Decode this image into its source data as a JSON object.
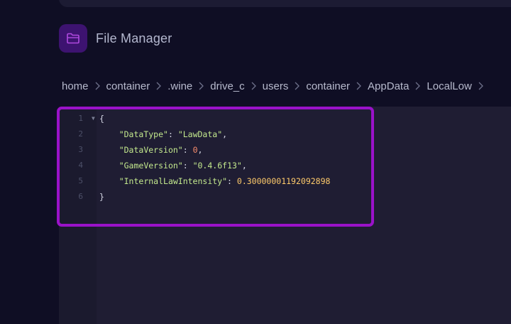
{
  "app": {
    "title": "File Manager",
    "icon": "folder-icon",
    "accent": "#9a12c9"
  },
  "breadcrumb": [
    "home",
    "container",
    ".wine",
    "drive_c",
    "users",
    "container",
    "AppData",
    "LocalLow"
  ],
  "editor": {
    "line_numbers": [
      "1",
      "2",
      "3",
      "4",
      "5",
      "6"
    ],
    "open_brace": "{",
    "close_brace": "}",
    "entries": [
      {
        "key": "\"DataType\"",
        "value": "\"LawData\"",
        "trail": ","
      },
      {
        "key": "\"DataVersion\"",
        "value": "0",
        "trail": ","
      },
      {
        "key": "\"GameVersion\"",
        "value": "\"0.4.6f13\"",
        "trail": ","
      },
      {
        "key": "\"InternalLawIntensity\"",
        "value": "0.30000001192092898",
        "trail": ""
      }
    ]
  }
}
